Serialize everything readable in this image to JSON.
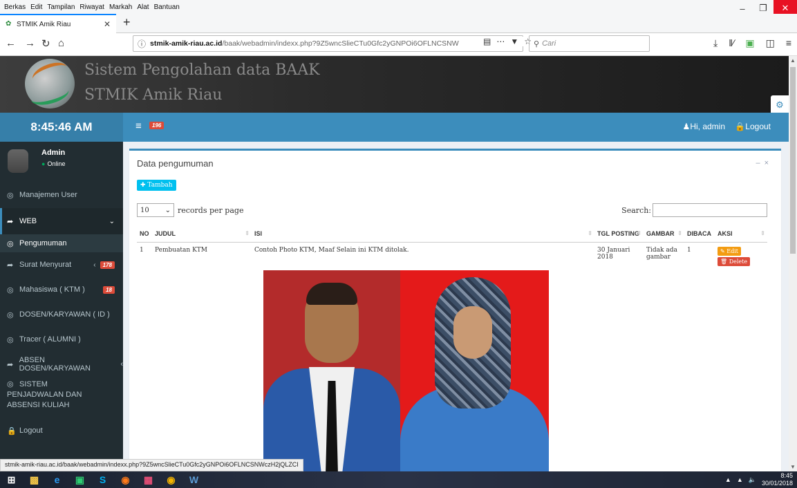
{
  "browser": {
    "menu": [
      {
        "label": "Berkas"
      },
      {
        "label": "Edit"
      },
      {
        "label": "Tampilan"
      },
      {
        "label": "Riwayat"
      },
      {
        "label": "Markah"
      },
      {
        "label": "Alat"
      },
      {
        "label": "Bantuan"
      }
    ],
    "tab_title": "STMIK Amik Riau",
    "url_host": "stmik-amik-riau.ac.id",
    "url_path": "/baak/webadmin/indexx.php?9Z5wncSlieCTu0Gfc2yGNPOi6OFLNCSNW",
    "search_placeholder": "Cari",
    "status_url": "stmik-amik-riau.ac.id/baak/webadmin/indexx.php?9Z5wncSlieCTu0Gfc2yGNPOi6OFLNCSNWczH2jQLZCI"
  },
  "header": {
    "title": "Sistem Pengolahan data BAAK",
    "subtitle": "STMIK Amik Riau",
    "clock": "8:45:46 AM",
    "notif_count": "196",
    "user_greeting": "Hi, admin",
    "logout_label": "Logout"
  },
  "sidebar": {
    "user_name": "Admin",
    "user_status": "Online",
    "items": [
      {
        "label": "Manajemen User"
      },
      {
        "label": "WEB"
      },
      {
        "label": "Pengumuman"
      },
      {
        "label": "Surat Menyurat",
        "badge": "178"
      },
      {
        "label": "Mahasiswa ( KTM )",
        "badge": "18"
      },
      {
        "label": "DOSEN/KARYAWAN ( ID )"
      },
      {
        "label": "Tracer ( ALUMNI )"
      },
      {
        "label": "ABSEN DOSEN/KARYAWAN"
      },
      {
        "label": "SISTEM PENJADWALAN DAN ABSENSI KULIAH"
      },
      {
        "label": "Logout"
      }
    ]
  },
  "main": {
    "box_title": "Data pengumuman",
    "add_button": "Tambah",
    "records_value": "10",
    "records_label": "records per page",
    "search_label": "Search:",
    "columns": [
      "NO",
      "JUDUL",
      "ISI",
      "TGL POSTING",
      "GAMBAR",
      "DIBACA",
      "AKSI"
    ],
    "rows": [
      {
        "no": "1",
        "judul": "Pembuatan KTM",
        "isi": "Contoh Photo KTM, Maaf Selain ini KTM ditolak.",
        "tgl": "30 Januari 2018",
        "gambar": "Tidak ada gambar",
        "dibaca": "1",
        "edit": "Edit",
        "delete": "Delete"
      }
    ]
  },
  "taskbar": {
    "time": "8:45",
    "date": "30/01/2018"
  },
  "colors": {
    "primary": "#3c8dbc",
    "sidebar_bg": "#222d32",
    "badge_red": "#dd4b39",
    "edit_orange": "#f39c12",
    "tambah_cyan": "#00c0ef"
  }
}
